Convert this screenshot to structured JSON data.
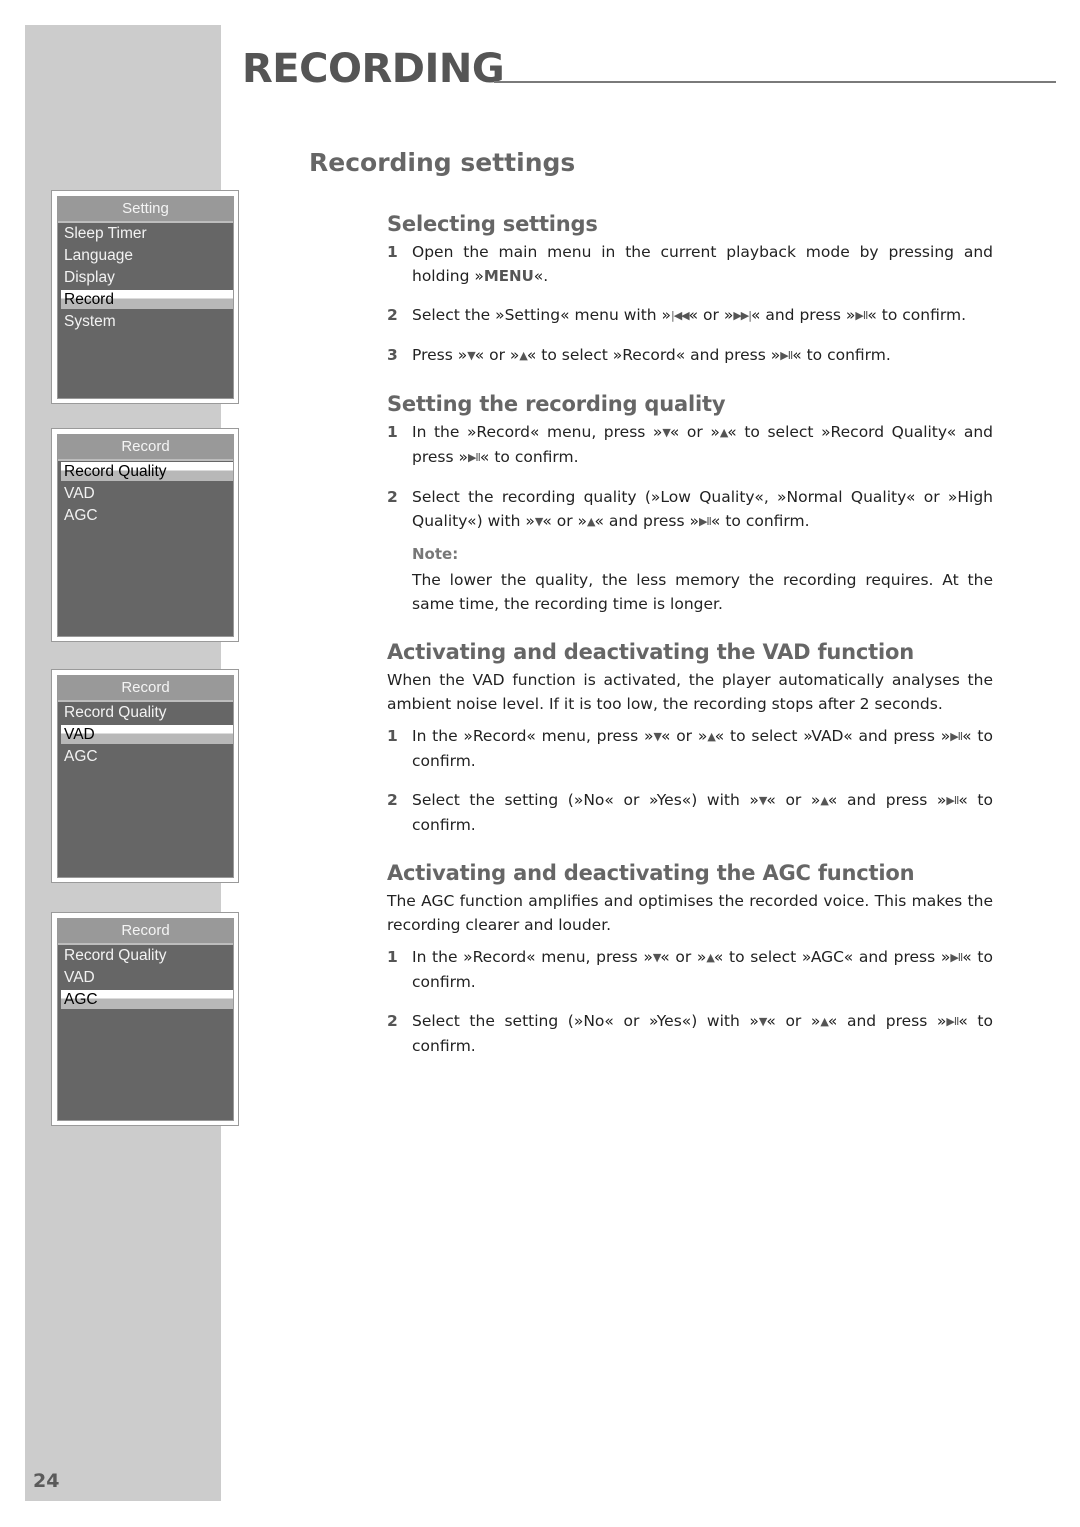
{
  "page": {
    "chapter_title": "RECORDING",
    "section_title": "Recording settings",
    "page_number": "24"
  },
  "screens": [
    {
      "header": "Setting",
      "items": [
        "Sleep Timer",
        "Language",
        "Display",
        "Record",
        "System"
      ],
      "selected": "Record"
    },
    {
      "header": "Record",
      "items": [
        "Record Quality",
        "VAD",
        "AGC"
      ],
      "selected": "Record Quality"
    },
    {
      "header": "Record",
      "items": [
        "Record Quality",
        "VAD",
        "AGC"
      ],
      "selected": "VAD"
    },
    {
      "header": "Record",
      "items": [
        "Record Quality",
        "VAD",
        "AGC"
      ],
      "selected": "AGC"
    }
  ],
  "icons": {
    "prev": "skip-back-icon",
    "next": "skip-forward-icon",
    "play_pause": "play-pause-icon",
    "down": "arrow-down-icon",
    "up": "arrow-up-icon"
  },
  "sections": {
    "selecting": {
      "title": "Selecting settings",
      "steps": [
        {
          "num": "1",
          "text_a": "Open the main menu in the current playback mode by pressing and holding »",
          "key": "MENU",
          "text_b": "«."
        },
        {
          "num": "2",
          "text_a": "Select the »Setting« menu with »",
          "text_b": "« or »",
          "text_c": "« and press »",
          "text_d": "« to confirm."
        },
        {
          "num": "3",
          "text_a": "Press »",
          "text_b": "« or »",
          "text_c": "« to select »Record« and press »",
          "text_d": "« to confirm."
        }
      ]
    },
    "quality": {
      "title": "Setting the recording quality",
      "steps": [
        {
          "num": "1",
          "text_a": "In the »Record« menu, press »",
          "text_b": "« or »",
          "text_c": "« to select »Record Quality« and press »",
          "text_d": "« to confirm."
        },
        {
          "num": "2",
          "text_a": "Select the recording quality (»Low Quality«, »Normal Quality« or »High Quality«) with »",
          "text_b": "« or »",
          "text_c": "« and press »",
          "text_d": "« to confirm."
        }
      ],
      "note_label": "Note:",
      "note_text": "The lower the quality, the less memory the recording requires. At the same time, the recording time is longer."
    },
    "vad": {
      "title": "Activating and deactivating the VAD function",
      "intro": "When the VAD function is activated, the player automatically analyses the ambient noise level. If it is too low, the recording stops after 2 seconds.",
      "steps": [
        {
          "num": "1",
          "text_a": "In the »Record« menu, press »",
          "text_b": "« or »",
          "text_c": "« to select »VAD« and press »",
          "text_d": "« to confirm."
        },
        {
          "num": "2",
          "text_a": "Select the setting (»No« or »Yes«) with »",
          "text_b": "« or »",
          "text_c": "« and press »",
          "text_d": "« to confirm."
        }
      ]
    },
    "agc": {
      "title": "Activating and deactivating the AGC function",
      "intro": "The AGC function amplifies and optimises the recorded voice. This makes the recording clearer and louder.",
      "steps": [
        {
          "num": "1",
          "text_a": "In the »Record« menu, press »",
          "text_b": "« or »",
          "text_c": "« to select »AGC« and press »",
          "text_d": "« to confirm."
        },
        {
          "num": "2",
          "text_a": "Select the setting (»No« or »Yes«) with »",
          "text_b": "« or »",
          "text_c": "« and press »",
          "text_d": "« to confirm."
        }
      ]
    }
  }
}
